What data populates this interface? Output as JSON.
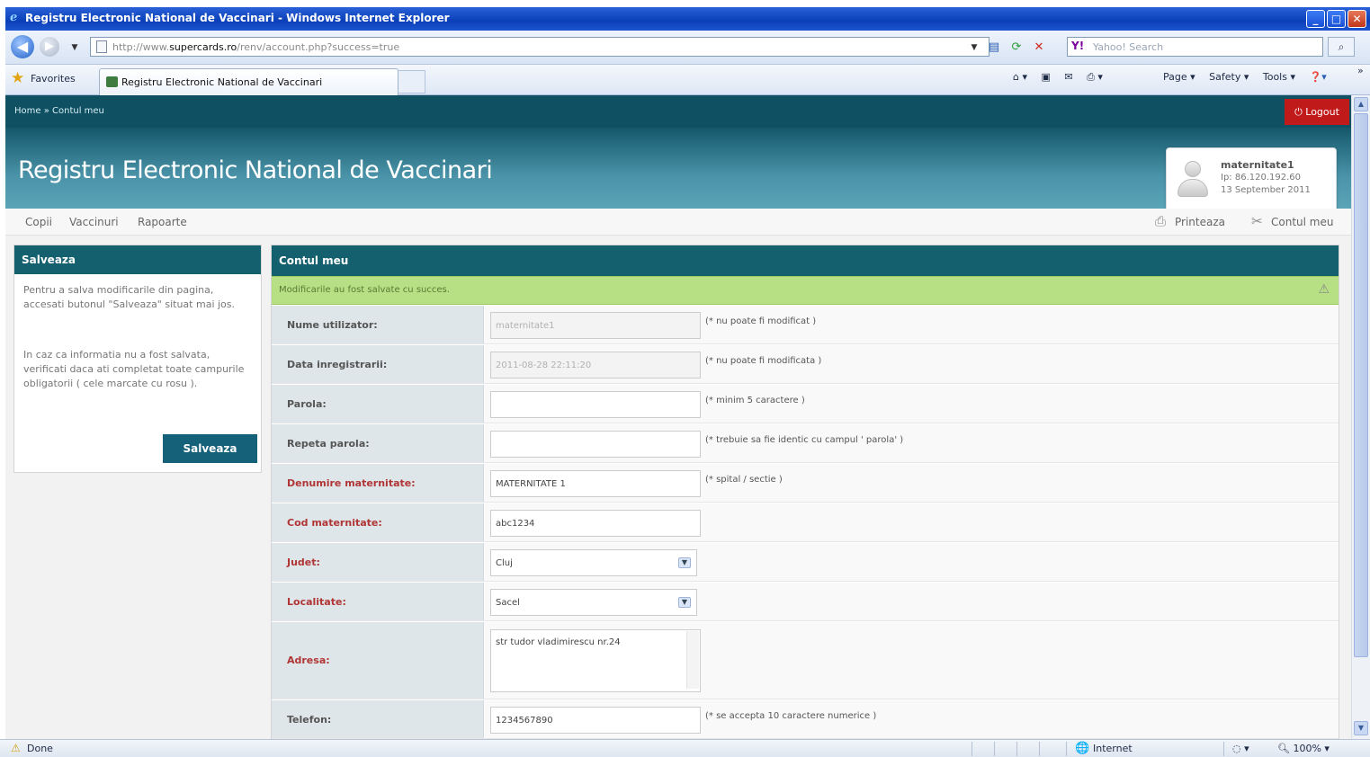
{
  "window": {
    "title": "Registru Electronic National de Vaccinari - Windows Internet Explorer",
    "min": "_",
    "max": "□",
    "close": "✕"
  },
  "address": {
    "url_prefix": "http://www.",
    "url_host": "supercards.ro",
    "url_suffix": "/renv/account.php?success=true",
    "search_placeholder": "Yahoo! Search",
    "yahoo_logo": "Y!"
  },
  "favbar": {
    "favorites_label": "Favorites",
    "tab_title": "Registru Electronic National de Vaccinari",
    "commands": [
      "Page ▾",
      "Safety ▾",
      "Tools ▾"
    ]
  },
  "site": {
    "breadcrumb": "Home » Contul meu",
    "logout_label": "Logout",
    "app_title": "Registru Electronic National de Vaccinari",
    "user": {
      "username": "maternitate1",
      "ip": "Ip: 86.120.192.60",
      "date": "13 September 2011"
    },
    "menu": [
      "Copii",
      "Vaccinuri",
      "Rapoarte"
    ],
    "right_tools": {
      "print_label": "Printeaza",
      "account_label": "Contul meu"
    }
  },
  "left_panel": {
    "title": "Salveaza",
    "para1": "Pentru a salva modificarile din pagina, accesati butonul \"Salveaza\" situat mai jos.",
    "para2": "In caz ca informatia nu a fost salvata, verificati daca ati completat toate campurile obligatorii ( cele marcate cu rosu ).",
    "save_button": "Salveaza"
  },
  "right_panel": {
    "title": "Contul meu",
    "success_message": "Modificarile au fost salvate cu succes.",
    "fields": {
      "username": {
        "label": "Nume utilizator:",
        "value": "maternitate1",
        "hint": "(* nu poate fi modificat )"
      },
      "regdate": {
        "label": "Data inregistrarii:",
        "value": "2011-08-28 22:11:20",
        "hint": "(* nu poate fi modificata )"
      },
      "password": {
        "label": "Parola:",
        "value": "",
        "hint": "(* minim 5 caractere )"
      },
      "password2": {
        "label": "Repeta parola:",
        "value": "",
        "hint": "(* trebuie sa fie identic cu campul ' parola' )"
      },
      "maternity_name": {
        "label": "Denumire maternitate:",
        "value": "MATERNITATE 1",
        "hint": "(* spital / sectie )"
      },
      "maternity_code": {
        "label": "Cod maternitate:",
        "value": "abc1234"
      },
      "county": {
        "label": "Judet:",
        "value": "Cluj"
      },
      "locality": {
        "label": "Localitate:",
        "value": "Sacel"
      },
      "address": {
        "label": "Adresa:",
        "value": "str tudor vladimirescu nr.24"
      },
      "phone": {
        "label": "Telefon:",
        "value": "1234567890",
        "hint": "(* se accepta 10 caractere numerice )"
      }
    }
  },
  "statusbar": {
    "status": "Done",
    "zone": "Internet",
    "zoom": "100%"
  },
  "colors": {
    "header_dark": "#0f5062",
    "panel_head": "#14606f",
    "logout_red": "#c01a1a",
    "success_green": "#b7df83",
    "required_label": "#b03636"
  }
}
